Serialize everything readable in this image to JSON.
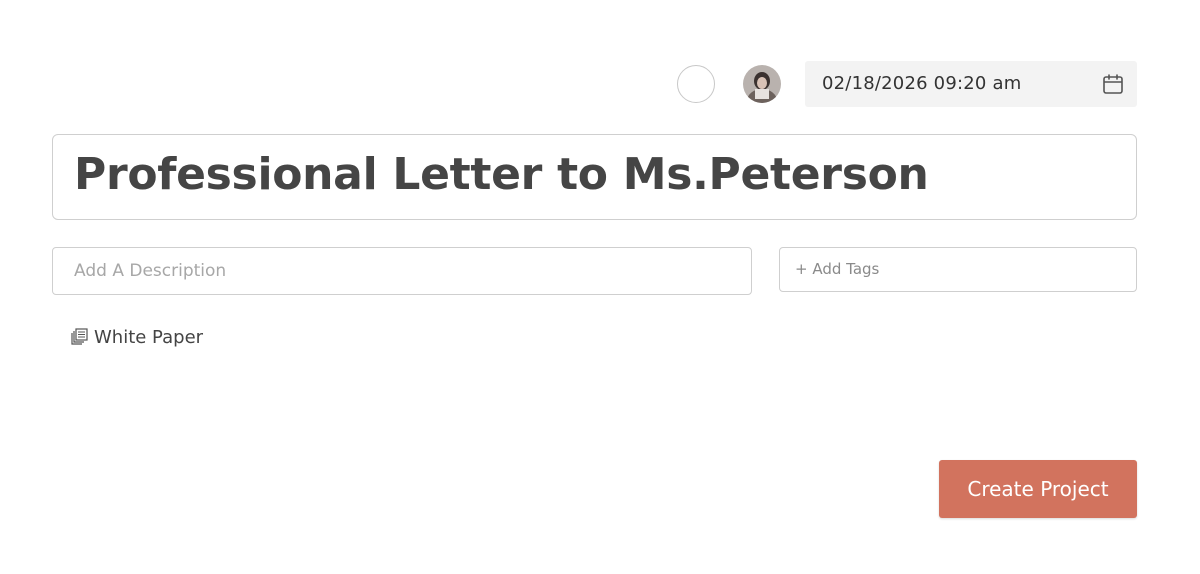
{
  "header": {
    "assignee_placeholder_icon": "empty-avatar-circle",
    "avatar_icon": "user-avatar",
    "due_date": "02/18/2026 09:20 am",
    "calendar_icon": "calendar-icon"
  },
  "project": {
    "title": "Professional Letter to Ms.Peterson",
    "description_placeholder": "Add A Description",
    "tags_placeholder": "+ Add Tags"
  },
  "template": {
    "icon": "pages-icon",
    "label": "White Paper"
  },
  "actions": {
    "create_label": "Create Project"
  },
  "colors": {
    "accent": "#d2735e",
    "date_field_bg": "#f3f3f3",
    "border": "#cfcfcf"
  }
}
